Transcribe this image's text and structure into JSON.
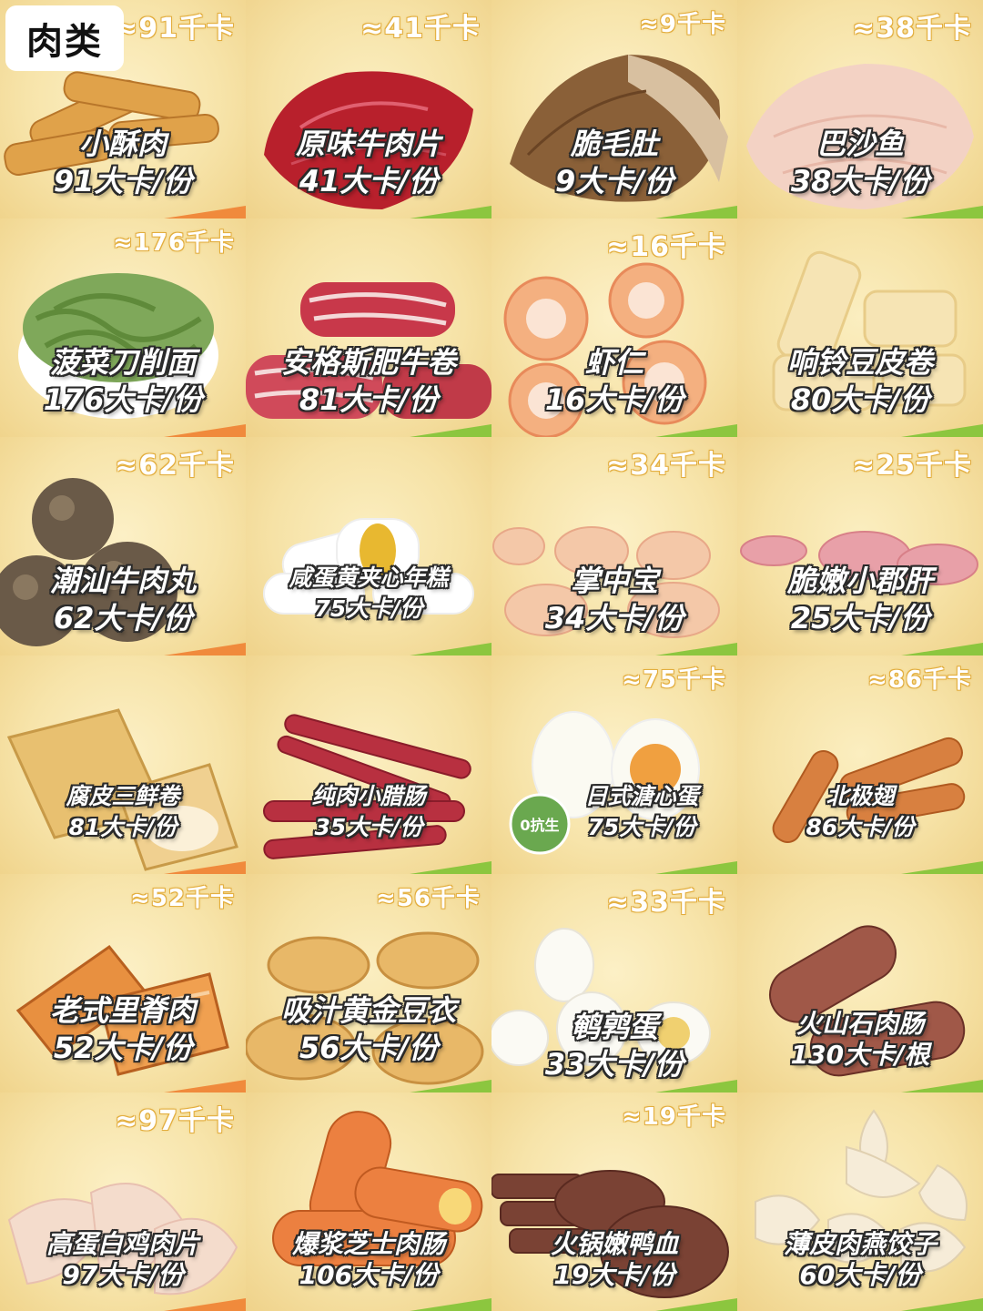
{
  "category": "肉类",
  "items": [
    {
      "kcal": "≈91千卡",
      "name": "小酥肉",
      "per": "91大卡/份",
      "icon": "fried-pork-icon"
    },
    {
      "kcal": "≈41千卡",
      "name": "原味牛肉片",
      "per": "41大卡/份",
      "icon": "beef-slices-icon"
    },
    {
      "kcal": "≈9千卡",
      "name": "脆毛肚",
      "per": "9大卡/份",
      "icon": "tripe-icon"
    },
    {
      "kcal": "≈38千卡",
      "name": "巴沙鱼",
      "per": "38大卡/份",
      "icon": "fish-fillet-icon"
    },
    {
      "kcal": "≈176千卡",
      "name": "菠菜刀削面",
      "per": "176大卡/份",
      "icon": "noodles-icon"
    },
    {
      "kcal": "",
      "name": "安格斯肥牛卷",
      "per": "81大卡/份",
      "icon": "beef-roll-icon"
    },
    {
      "kcal": "≈16千卡",
      "name": "虾仁",
      "per": "16大卡/份",
      "icon": "shrimp-icon"
    },
    {
      "kcal": "",
      "name": "响铃豆皮卷",
      "per": "80大卡/份",
      "icon": "tofu-skin-roll-icon"
    },
    {
      "kcal": "≈62千卡",
      "name": "潮汕牛肉丸",
      "per": "62大卡/份",
      "icon": "meatball-icon"
    },
    {
      "kcal": "",
      "name": "咸蛋黄夹心年糕",
      "per": "75大卡/份",
      "icon": "rice-cake-icon"
    },
    {
      "kcal": "≈34千卡",
      "name": "掌中宝",
      "per": "34大卡/份",
      "icon": "chicken-cartilage-icon"
    },
    {
      "kcal": "≈25千卡",
      "name": "脆嫩小郡肝",
      "per": "25大卡/份",
      "icon": "gizzard-icon"
    },
    {
      "kcal": "",
      "name": "腐皮三鲜卷",
      "per": "81大卡/份",
      "icon": "tofu-roll-icon"
    },
    {
      "kcal": "",
      "name": "纯肉小腊肠",
      "per": "35大卡/份",
      "icon": "sausage-icon"
    },
    {
      "kcal": "≈75千卡",
      "name": "日式溏心蛋",
      "per": "75大卡/份",
      "icon": "egg-icon",
      "badge": "0抗生"
    },
    {
      "kcal": "≈86千卡",
      "name": "北极翅",
      "per": "86大卡/份",
      "icon": "wing-icon"
    },
    {
      "kcal": "≈52千卡",
      "name": "老式里脊肉",
      "per": "52大卡/份",
      "icon": "tenderloin-icon"
    },
    {
      "kcal": "≈56千卡",
      "name": "吸汁黄金豆衣",
      "per": "56大卡/份",
      "icon": "tofu-puff-icon"
    },
    {
      "kcal": "≈33千卡",
      "name": "鹌鹑蛋",
      "per": "33大卡/份",
      "icon": "quail-egg-icon"
    },
    {
      "kcal": "",
      "name": "火山石肉肠",
      "per": "130大卡/根",
      "icon": "grilled-sausage-icon"
    },
    {
      "kcal": "≈97千卡",
      "name": "高蛋白鸡肉片",
      "per": "97大卡/份",
      "icon": "chicken-slices-icon"
    },
    {
      "kcal": "",
      "name": "爆浆芝士肉肠",
      "per": "106大卡/份",
      "icon": "cheese-sausage-icon"
    },
    {
      "kcal": "≈19千卡",
      "name": "火锅嫩鸭血",
      "per": "19大卡/份",
      "icon": "duck-blood-icon"
    },
    {
      "kcal": "",
      "name": "薄皮肉燕饺子",
      "per": "60大卡/份",
      "icon": "dumpling-icon"
    }
  ]
}
